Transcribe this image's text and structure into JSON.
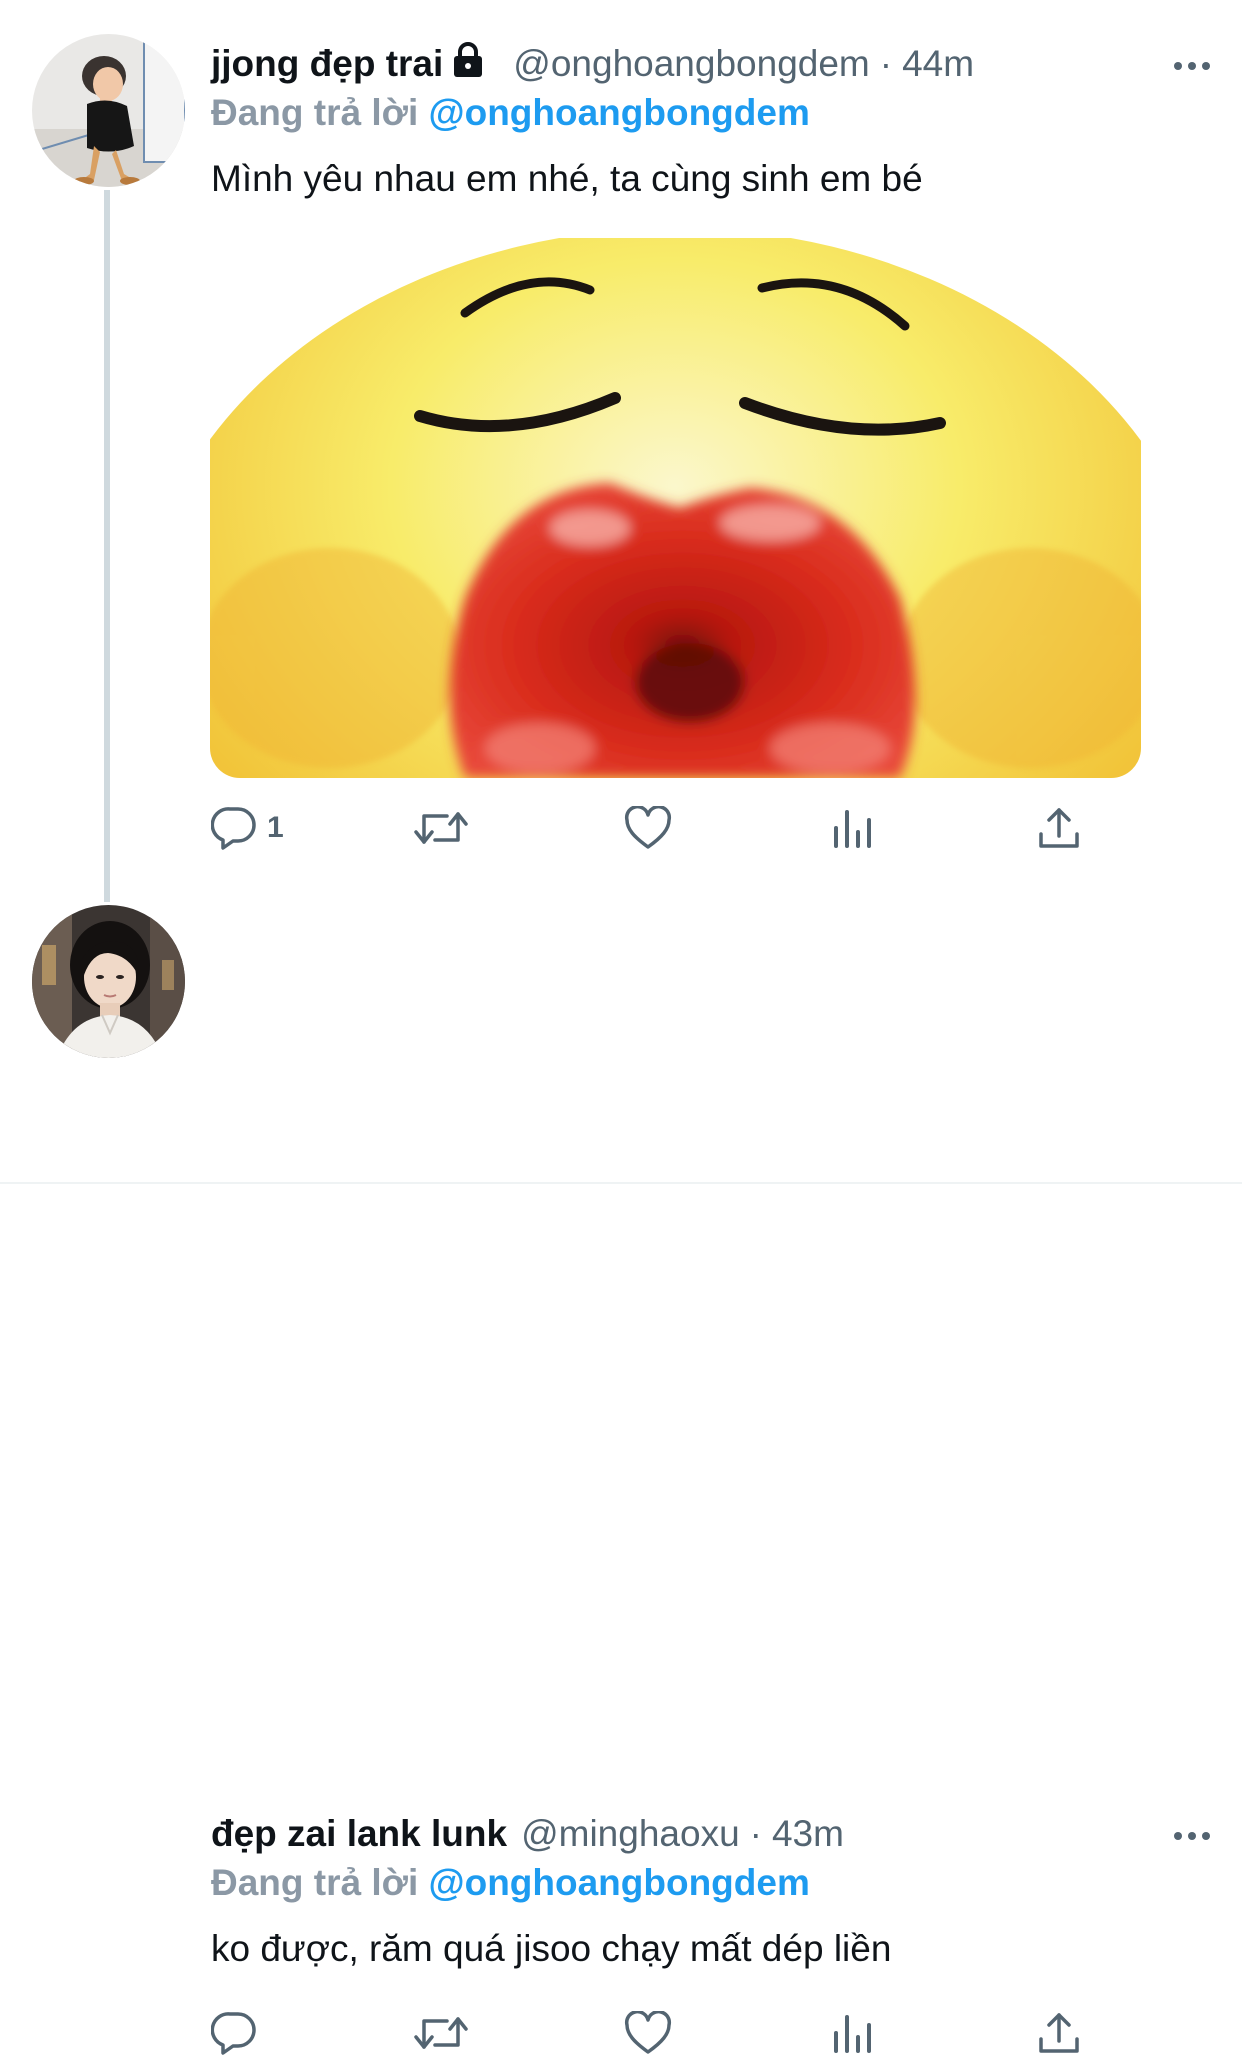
{
  "tweets": [
    {
      "display_name": "jjong đẹp trai",
      "protected": true,
      "handle": "@onghoangbongdem",
      "separator": "·",
      "time": "44m",
      "replying_prefix": "Đang trả lời",
      "replying_to": "@onghoangbongdem",
      "text": "Mình yêu nhau em nhé, ta cùng sinh em bé",
      "media": "kissing-emoji-image",
      "reply_count": "1",
      "icons": [
        "reply-icon",
        "retweet-icon",
        "like-icon",
        "analytics-icon",
        "share-icon",
        "more-icon",
        "lock-icon"
      ]
    },
    {
      "display_name": "đẹp zai lank lunk",
      "protected": false,
      "handle": "@minghaoxu",
      "separator": "·",
      "time": "43m",
      "replying_prefix": "Đang trả lời",
      "replying_to": "@onghoangbongdem",
      "text": "ko được, răm quá jisoo chạy mất dép liền",
      "reply_count": "",
      "icons": [
        "reply-icon",
        "retweet-icon",
        "like-icon",
        "analytics-icon",
        "share-icon",
        "more-icon"
      ]
    }
  ],
  "colors": {
    "text_primary": "#0f1419",
    "text_secondary": "#536471",
    "mention_blue": "#1d9bf0",
    "thread_line": "#cfd9de"
  }
}
